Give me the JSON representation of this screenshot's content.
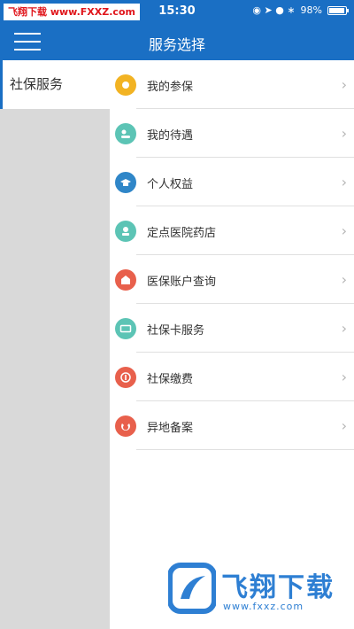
{
  "statusbar": {
    "watermark": "飞翔下载 www.FXXZ.com",
    "time": "15:30",
    "icons": "◉ ➤ ● ∗",
    "battery_text": "98%"
  },
  "header": {
    "title": "服务选择",
    "menu_icon": "menu-icon"
  },
  "sidebar": {
    "items": [
      {
        "label": "社保服务"
      }
    ]
  },
  "services": [
    {
      "label": "我的参保",
      "icon": "insured-icon",
      "color": "#f2b323"
    },
    {
      "label": "我的待遇",
      "icon": "benefits-icon",
      "color": "#5cc4b5"
    },
    {
      "label": "个人权益",
      "icon": "rights-icon",
      "color": "#2f86c8"
    },
    {
      "label": "定点医院药店",
      "icon": "hospital-icon",
      "color": "#5cc4b5"
    },
    {
      "label": "医保账户查询",
      "icon": "medical-account-icon",
      "color": "#e8604c"
    },
    {
      "label": "社保卡服务",
      "icon": "card-icon",
      "color": "#5cc4b5"
    },
    {
      "label": "社保缴费",
      "icon": "payment-icon",
      "color": "#e8604c"
    },
    {
      "label": "异地备案",
      "icon": "filing-icon",
      "color": "#e8604c"
    }
  ],
  "watermark_logo": {
    "text": "飞翔下载",
    "url": "www.fxxz.com",
    "color": "#2e7fd3"
  }
}
